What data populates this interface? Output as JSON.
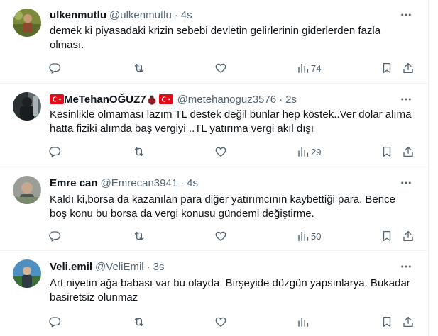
{
  "colors": {
    "text": "#0f1419",
    "secondary": "#536471",
    "divider": "#eff3f4",
    "flag_red": "#e30a17"
  },
  "tweets": [
    {
      "display_name": "ulkenmutlu",
      "handle": "@ulkenmutlu",
      "separator": "·",
      "time": "4s",
      "text_line1": "demek ki piyasadaki krizin sebebi devletin gelirlerinin giderlerden fazla",
      "text_line2": "olması.",
      "views": "74",
      "avatar_color": "#6b7a3a"
    },
    {
      "display_name": "MeTehanOĞUZ7",
      "handle": "@metehanoguz3576",
      "separator": "·",
      "time": "2s",
      "text_line1": "Kesinlikle olmaması lazım TL destek değil bunlar hep köstek..Ver dolar alıma",
      "text_line2": "hatta fiziki alımda baş vergiyi ..TL yatırıma vergi akıl dışı",
      "views": "29",
      "name_icons": [
        "turkish-flag-icon",
        "ladybug-icon",
        "turkish-flag-icon"
      ],
      "avatar_color": "#3a3f44"
    },
    {
      "display_name": "Emre can",
      "handle": "@Emrecan3941",
      "separator": "·",
      "time": "4s",
      "text_line1": "Kaldı ki,borsa da kazanılan para diğer yatırımcının kaybettiği para. Bence",
      "text_line2": "boş konu bu borsa da vergi konusu gündemi değiştirme.",
      "views": "50",
      "avatar_color": "#8c8f8a"
    },
    {
      "display_name": "Veli.emil",
      "handle": "@VeliEmil",
      "separator": "·",
      "time": "3s",
      "text_line1": "Art niyetin ağa babası var bu olayda. Birşeyide düzgün yapsınlarya. Bukadar",
      "text_line2": "basiretsiz olunmaz",
      "avatar_color": "#3f7fa8"
    }
  ],
  "icons": {
    "more": "more-horizontal-icon",
    "reply": "reply-icon",
    "retweet": "retweet-icon",
    "like": "heart-icon",
    "views": "views-chart-icon",
    "bookmark": "bookmark-icon",
    "share": "share-icon"
  }
}
